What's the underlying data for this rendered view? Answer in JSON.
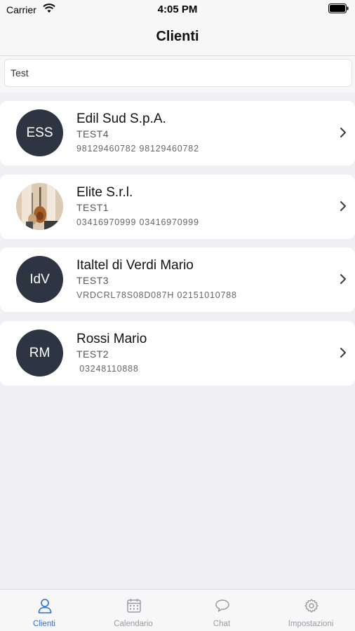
{
  "status_bar": {
    "carrier": "Carrier",
    "time": "4:05 PM"
  },
  "nav": {
    "title": "Clienti"
  },
  "search": {
    "value": "Test",
    "placeholder": ""
  },
  "clients": [
    {
      "initials": "ESS",
      "avatar_type": "initials",
      "name": "Edil Sud S.p.A.",
      "code": "TEST4",
      "phones": "98129460782 98129460782"
    },
    {
      "initials": "",
      "avatar_type": "photo",
      "name": "Elite S.r.l.",
      "code": "TEST1",
      "phones": "03416970999 03416970999"
    },
    {
      "initials": "IdV",
      "avatar_type": "initials",
      "name": "Italtel di Verdi Mario",
      "code": "TEST3",
      "phones": "VRDCRL78S08D087H 02151010788"
    },
    {
      "initials": "RM",
      "avatar_type": "initials",
      "name": "Rossi Mario",
      "code": "TEST2",
      "phones": " 03248110888"
    }
  ],
  "tabs": [
    {
      "label": "Clienti",
      "icon": "person-icon",
      "active": true
    },
    {
      "label": "Calendario",
      "icon": "calendar-icon",
      "active": false
    },
    {
      "label": "Chat",
      "icon": "chat-bubble-icon",
      "active": false
    },
    {
      "label": "Impostazioni",
      "icon": "gear-icon",
      "active": false
    }
  ],
  "colors": {
    "accent": "#2f6fce",
    "avatar_bg": "#2e3542",
    "background": "#efeff4"
  }
}
